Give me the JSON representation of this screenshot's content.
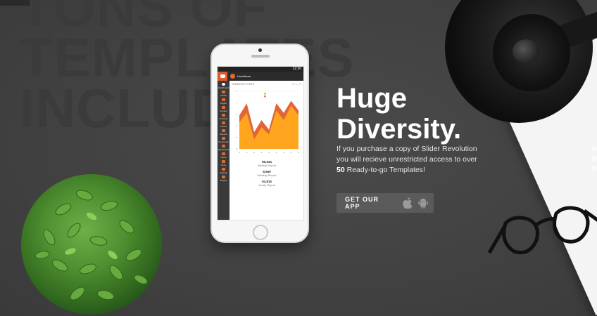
{
  "background": {
    "big_text_lines": [
      "TONS OF",
      "TEMPLATES",
      "INCLUDED"
    ]
  },
  "hero": {
    "headline_line1": "Huge",
    "headline_line2": "Diversity.",
    "description_part1": "If you purchase a copy of Slider Revolution you will recieve unrestricted access to over",
    "description_highlight": "50",
    "description_part2": "Ready-to-go Templates!",
    "cta_label": "GET OUR APP"
  },
  "phone_app": {
    "status_time": "12:30",
    "user_name": "UserName",
    "chart_title": "WEBSITE STATS",
    "sidebar": [
      "Dashboard",
      "Media",
      "Pages",
      "Contact",
      "Products",
      "Orders",
      "Reports",
      "Comments",
      "Appearance",
      "Users",
      "Tools",
      "Settings",
      "Plugins"
    ],
    "stats": [
      {
        "value": "86,934",
        "label": "Weekly Report"
      },
      {
        "value": "8,669",
        "label": "Monthly Report"
      },
      {
        "value": "94,816",
        "label": "Yearly Report"
      }
    ]
  },
  "colors": {
    "accent": "#ff9f1c",
    "accent_dark": "#e05a2a",
    "button_bg": "#5a5a5a"
  },
  "chart_data": {
    "type": "area",
    "title": "",
    "x": [
      1,
      2,
      3,
      4,
      5,
      6,
      7,
      8,
      9
    ],
    "series": [
      {
        "name": "",
        "values": [
          70,
          95,
          35,
          60,
          40,
          95,
          75,
          100,
          80
        ]
      },
      {
        "name": "",
        "values": [
          55,
          75,
          20,
          45,
          30,
          80,
          60,
          90,
          70
        ]
      }
    ],
    "ylim": [
      0,
      120
    ],
    "grid": true
  }
}
